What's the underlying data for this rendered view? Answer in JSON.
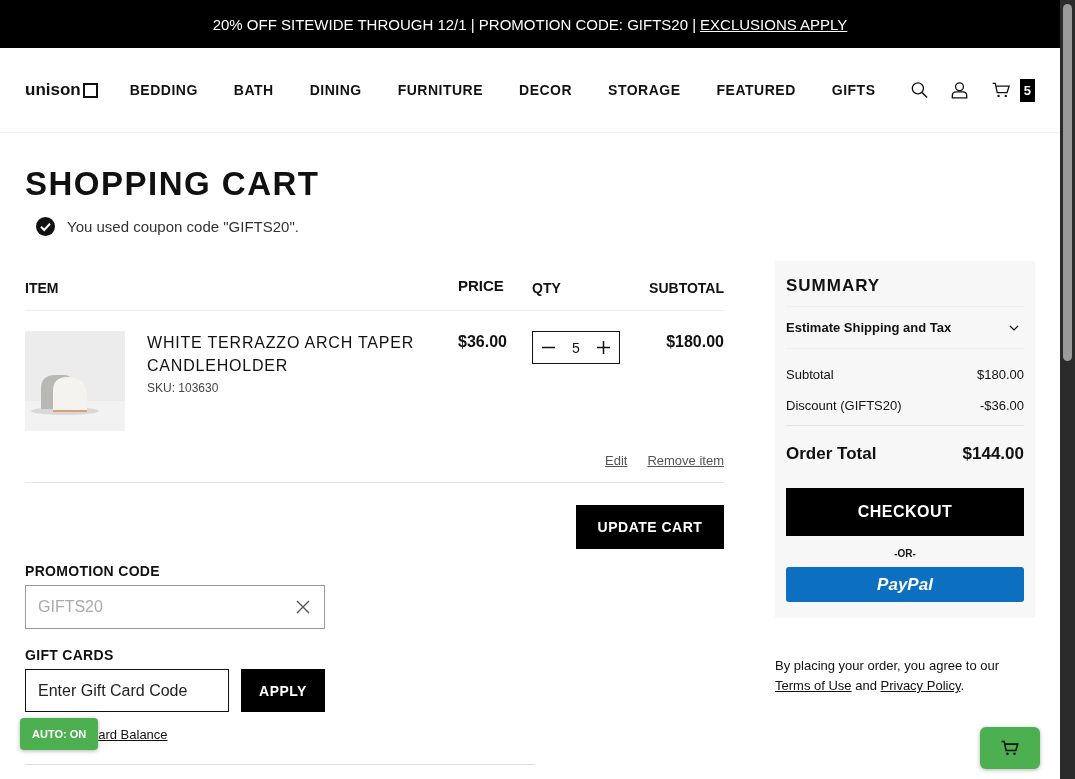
{
  "promo_banner": {
    "text": "20% OFF SITEWIDE THROUGH 12/1 | PROMOTION CODE: GIFTS20 |",
    "link": "EXCLUSIONS APPLY"
  },
  "header": {
    "logo": "unison",
    "nav": [
      "BEDDING",
      "BATH",
      "DINING",
      "FURNITURE",
      "DECOR",
      "STORAGE",
      "FEATURED",
      "GIFTS"
    ],
    "cart_count": "5"
  },
  "page_title": "SHOPPING CART",
  "coupon_message": "You used coupon code \"GIFTS20\".",
  "cart_table": {
    "columns": [
      "ITEM",
      "PRICE",
      "QTY",
      "SUBTOTAL"
    ],
    "rows": [
      {
        "name": "WHITE TERRAZZO ARCH TAPER CANDLEHOLDER",
        "sku": "SKU: 103630",
        "price": "$36.00",
        "qty": "5",
        "subtotal": "$180.00",
        "actions": [
          "Edit",
          "Remove item"
        ]
      }
    ]
  },
  "update_button": "UPDATE CART",
  "promotion_code": {
    "label": "PROMOTION CODE",
    "value": "GIFTS20"
  },
  "gift_cards": {
    "label": "GIFT CARDS",
    "placeholder": "Enter Gift Card Code",
    "button": "APPLY",
    "balance_link": "ard Balance"
  },
  "summary": {
    "title": "SUMMARY",
    "estimate": "Estimate Shipping and Tax",
    "expanded": false,
    "lines": [
      {
        "label": "Subtotal",
        "value": "$180.00"
      },
      {
        "label": "Discount (GIFTS20)",
        "value": "-$36.00"
      }
    ],
    "total": {
      "label": "Order Total",
      "value": "$144.00"
    },
    "checkout": "CHECKOUT",
    "or": "-OR-",
    "paypal": "PayPal"
  },
  "agreement": {
    "text": "By placing your order, you agree to our",
    "link1": "Terms of Use",
    "and": "and",
    "link2": "Privacy Policy",
    "end": "."
  },
  "auto_badge": "AUTO: ON"
}
